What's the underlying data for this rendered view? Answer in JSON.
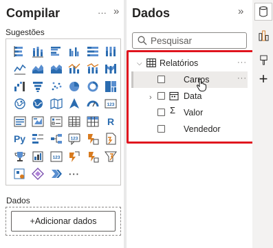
{
  "compilar_pane": {
    "title": "Compilar",
    "sugestoes_label": "Sugestões",
    "viz_icons": [
      "stacked-bar-icon",
      "stacked-column-icon",
      "clustered-bar-icon",
      "clustered-column-icon",
      "100-stacked-bar-icon",
      "100-stacked-column-icon",
      "line-chart-icon",
      "area-chart-icon",
      "stacked-area-icon",
      "line-clustered-column-icon",
      "line-stacked-column-icon",
      "ribbon-chart-icon",
      "waterfall-icon",
      "funnel-icon",
      "scatter-icon",
      "pie-chart-icon",
      "donut-chart-icon",
      "treemap-icon",
      "map-icon",
      "filled-map-icon",
      "shape-map-icon",
      "azure-map-icon",
      "gauge-icon",
      "card-icon",
      "multi-row-card-icon",
      "kpi-icon",
      "slicer-icon",
      "table-icon",
      "matrix-icon",
      "r-visual-icon",
      "python-visual-icon",
      "key-influencers-icon",
      "decomposition-tree-icon",
      "qa-icon",
      "smart-narrative-icon",
      "paginated-report-icon",
      "trophy-icon",
      "power-apps-icon",
      "power-automate-icon",
      "custom-visual-icon",
      "custom-visual-2-icon",
      "custom-visual-3-icon",
      "custom-visual-4-icon",
      "diamond-icon",
      "chevron-visual-icon",
      "more-visuals-icon"
    ],
    "r_label": "R",
    "py_label": "Py",
    "card_label": "123",
    "more_glyph": "···",
    "dados_label": "Dados",
    "add_button_label": "+Adicionar dados"
  },
  "dados_pane": {
    "title": "Dados",
    "search_placeholder": "Pesquisar",
    "table": {
      "name": "Relatórios",
      "fields": [
        {
          "name": "Carros",
          "type": "text"
        },
        {
          "name": "Data",
          "type": "date-hierarchy"
        },
        {
          "name": "Valor",
          "type": "sum"
        },
        {
          "name": "Vendedor",
          "type": "text"
        }
      ]
    }
  },
  "header_icons": {
    "more": "···",
    "expand": "»"
  },
  "colors": {
    "accent": "#e0141e",
    "pane_bg": "#ffffff",
    "chrome_bg": "#e9e9e9",
    "icon_blue": "#2b6cb0",
    "icon_orange": "#d87b1f"
  }
}
